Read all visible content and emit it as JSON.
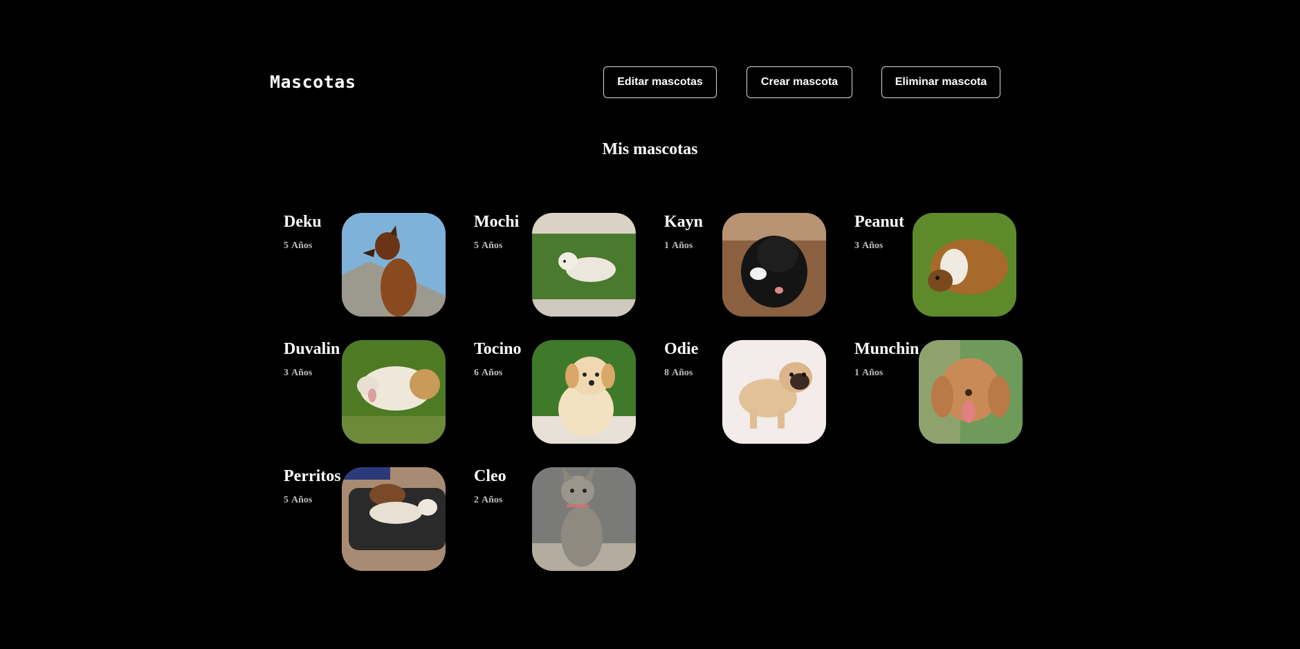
{
  "header": {
    "brand": "Mascotas",
    "buttons": {
      "edit": "Editar mascotas",
      "create": "Crear mascota",
      "delete": "Eliminar mascota"
    }
  },
  "main": {
    "title": "Mis mascotas",
    "age_unit": "Años",
    "pets": [
      {
        "name": "Deku",
        "age": "5",
        "photo": "brown-dog-photo"
      },
      {
        "name": "Mochi",
        "age": "5",
        "photo": "white-dog-on-grass-photo"
      },
      {
        "name": "Kayn",
        "age": "1",
        "photo": "black-poodle-photo"
      },
      {
        "name": "Peanut",
        "age": "3",
        "photo": "guinea-pig-photo"
      },
      {
        "name": "Duvalin",
        "age": "3",
        "photo": "guinea-pig-in-grass-photo"
      },
      {
        "name": "Tocino",
        "age": "6",
        "photo": "golden-puppy-photo"
      },
      {
        "name": "Odie",
        "age": "8",
        "photo": "pug-puppy-photo"
      },
      {
        "name": "Munchin",
        "age": "1",
        "photo": "cocker-puppy-photo"
      },
      {
        "name": "Perritos",
        "age": "5",
        "photo": "two-dogs-on-cushion-photo"
      },
      {
        "name": "Cleo",
        "age": "2",
        "photo": "tabby-cat-photo"
      }
    ]
  }
}
